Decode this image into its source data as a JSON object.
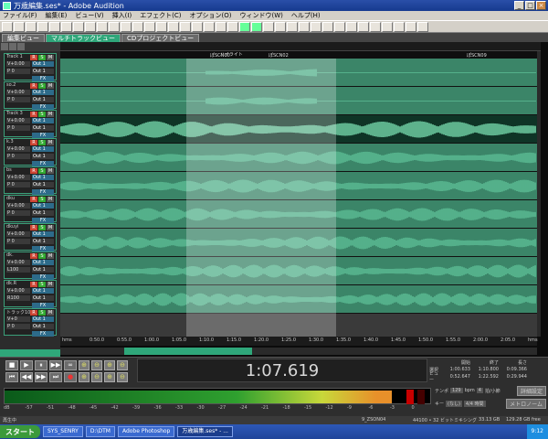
{
  "window": {
    "title": "万歳編集.ses* - Adobe Audition"
  },
  "menu": [
    "ファイル(F)",
    "編集(E)",
    "ビュー(V)",
    "挿入(I)",
    "エフェクト(C)",
    "オプション(O)",
    "ウィンドウ(W)",
    "ヘルプ(H)"
  ],
  "tabs": [
    {
      "label": "編集ビュー"
    },
    {
      "label": "マルチトラックビュー"
    },
    {
      "label": "CDプロジェクトビュー"
    }
  ],
  "tracks": [
    {
      "name": "Track 1",
      "vol": "V+0.00",
      "ch": "Out 1",
      "pan": "P 0",
      "ch2": "Out 1",
      "fx": "FX"
    },
    {
      "name": "so.2",
      "vol": "V+0.00",
      "ch": "Out 1",
      "pan": "P 0",
      "ch2": "Out 1",
      "fx": "FX"
    },
    {
      "name": "Track 3",
      "vol": "V+0.00",
      "ch": "Out 1",
      "pan": "P 0",
      "ch2": "Out 1",
      "fx": "FX"
    },
    {
      "name": "k.3",
      "vol": "V+0.00",
      "ch": "Out 1",
      "pan": "P 0",
      "ch2": "Out 1",
      "fx": "FX"
    },
    {
      "name": "bs",
      "vol": "V+0.00",
      "ch": "Out 1",
      "pan": "P 0",
      "ch2": "Out 1",
      "fx": "FX"
    },
    {
      "name": "dku",
      "vol": "V+0.00",
      "ch": "Out 1",
      "pan": "P 0",
      "ch2": "Out 1",
      "fx": "FX"
    },
    {
      "name": "dkuyi",
      "vol": "V+0.00",
      "ch": "Out 1",
      "pan": "P 0",
      "ch2": "Out 1",
      "fx": "FX"
    },
    {
      "name": "dk.",
      "vol": "V+0.00",
      "ch": "Out 1",
      "pan": "L100",
      "ch2": "Out 1",
      "fx": "FX"
    },
    {
      "name": "dk.R",
      "vol": "V+0.00",
      "ch": "Out 1",
      "pan": "R100",
      "ch2": "Out 1",
      "fx": "FX"
    },
    {
      "name": "トラック10",
      "vol": "V+0",
      "ch": "Out 1",
      "pan": "P 0",
      "ch2": "Out 1",
      "fx": "FX"
    }
  ],
  "markers": [
    "ハイライト",
    "ぽSCN10",
    "ぽSCN02",
    "ぽSCN09"
  ],
  "timeline_ticks": [
    "hms",
    "0:50.0",
    "0:55.0",
    "1:00.0",
    "1:05.0",
    "1:10.0",
    "1:15.0",
    "1:20.0",
    "1:25.0",
    "1:30.0",
    "1:35.0",
    "1:40.0",
    "1:45.0",
    "1:50.0",
    "1:55.0",
    "2:00.0",
    "2:05.0",
    "hms"
  ],
  "transport": {
    "time": "1:07.619",
    "buttons": [
      "■",
      "▶",
      "⏸",
      "▶▶",
      "∞",
      "⏮",
      "◀◀",
      "▶▶",
      "⏭",
      "●"
    ],
    "zoom_buttons": [
      "⊕",
      "⊖",
      "⊕",
      "⊖",
      "⊕",
      "⊖",
      "⊕",
      "⊖"
    ]
  },
  "selection": {
    "headers": [
      "開始",
      "終了",
      "長さ"
    ],
    "rows": [
      {
        "label": "選択",
        "start": "1:00.633",
        "end": "1:10.800",
        "length": "0:09.366"
      },
      {
        "label": "ビュー",
        "start": "0:52.647",
        "end": "1:22.592",
        "length": "0:29.944"
      }
    ]
  },
  "level": {
    "fill_fraction": 0.91,
    "scale": [
      "dB",
      "-57",
      "-51",
      "-48",
      "-45",
      "-42",
      "-39",
      "-36",
      "-33",
      "-30",
      "-27",
      "-24",
      "-21",
      "-18",
      "-15",
      "-12",
      "-9",
      "-6",
      "-3",
      "0"
    ]
  },
  "controls": {
    "tempo_label": "テンポ",
    "tempo": "129",
    "bpm": "bpm",
    "beats": "4",
    "beats_label": "拍/小節",
    "key_label": "キー",
    "key": "(なし)",
    "time_sig": "4/4 時間",
    "advanced": "詳細設定",
    "metronome": "メトロノーム"
  },
  "status": {
    "left": "再生中",
    "mid": "9_ZSON04",
    "fmt": "44100 • 32 ビットミキシング",
    "size": "33.13 GB",
    "free": "129.28 GB free"
  },
  "taskbar": {
    "start": "スタート",
    "items": [
      "SYS_SENRY",
      "D:\\DTM",
      "Adobe Photoshop",
      "万歳編集.ses* - ..."
    ],
    "clock": "9:12"
  }
}
